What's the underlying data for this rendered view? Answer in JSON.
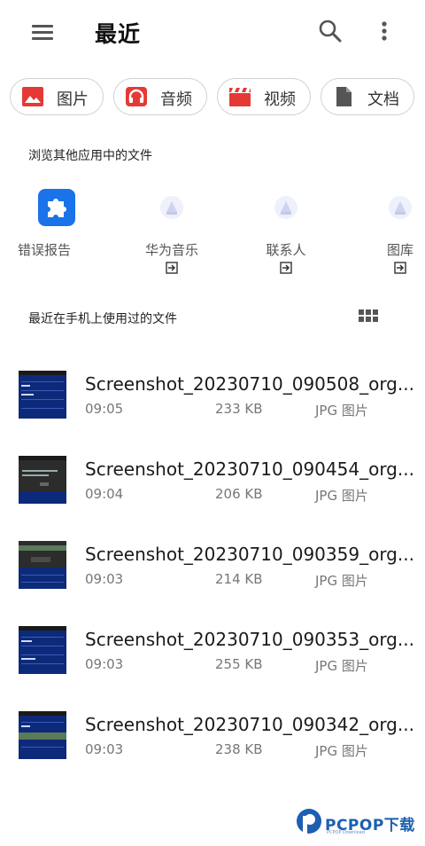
{
  "header": {
    "title": "最近",
    "menu_icon": "hamburger-menu-icon",
    "search_icon": "search-icon",
    "more_icon": "more-vertical-icon"
  },
  "categories": [
    {
      "label": "图片",
      "icon": "image-icon",
      "color": "#e53935"
    },
    {
      "label": "音频",
      "icon": "headphones-icon",
      "color": "#e53935"
    },
    {
      "label": "视频",
      "icon": "clapperboard-icon",
      "color": "#e53935"
    },
    {
      "label": "文档",
      "icon": "document-icon",
      "color": "#555555"
    }
  ],
  "other_apps": {
    "title": "浏览其他应用中的文件",
    "items": [
      {
        "label": "错误报告",
        "icon": "puzzle-icon",
        "color": "#1a73e8"
      },
      {
        "label": "华为音乐",
        "icon": "app-placeholder-icon",
        "open_icon": "open-in-app-icon"
      },
      {
        "label": "联系人",
        "icon": "app-placeholder-icon",
        "open_icon": "open-in-app-icon"
      },
      {
        "label": "图库",
        "icon": "app-placeholder-icon",
        "open_icon": "open-in-app-icon"
      }
    ]
  },
  "recent_files": {
    "title": "最近在手机上使用过的文件",
    "view_toggle_icon": "grid-view-icon",
    "items": [
      {
        "name": "Screenshot_20230710_090508_org....",
        "time": "09:05",
        "size": "233 KB",
        "type": "JPG 图片"
      },
      {
        "name": "Screenshot_20230710_090454_org....",
        "time": "09:04",
        "size": "206 KB",
        "type": "JPG 图片"
      },
      {
        "name": "Screenshot_20230710_090359_org....",
        "time": "09:03",
        "size": "214 KB",
        "type": "JPG 图片"
      },
      {
        "name": "Screenshot_20230710_090353_org....",
        "time": "09:03",
        "size": "255 KB",
        "type": "JPG 图片"
      },
      {
        "name": "Screenshot_20230710_090342_org....",
        "time": "09:03",
        "size": "238 KB",
        "type": "JPG 图片"
      }
    ]
  },
  "watermark": {
    "brand": "PCPOP下载",
    "sub": "PCPOP Download"
  }
}
